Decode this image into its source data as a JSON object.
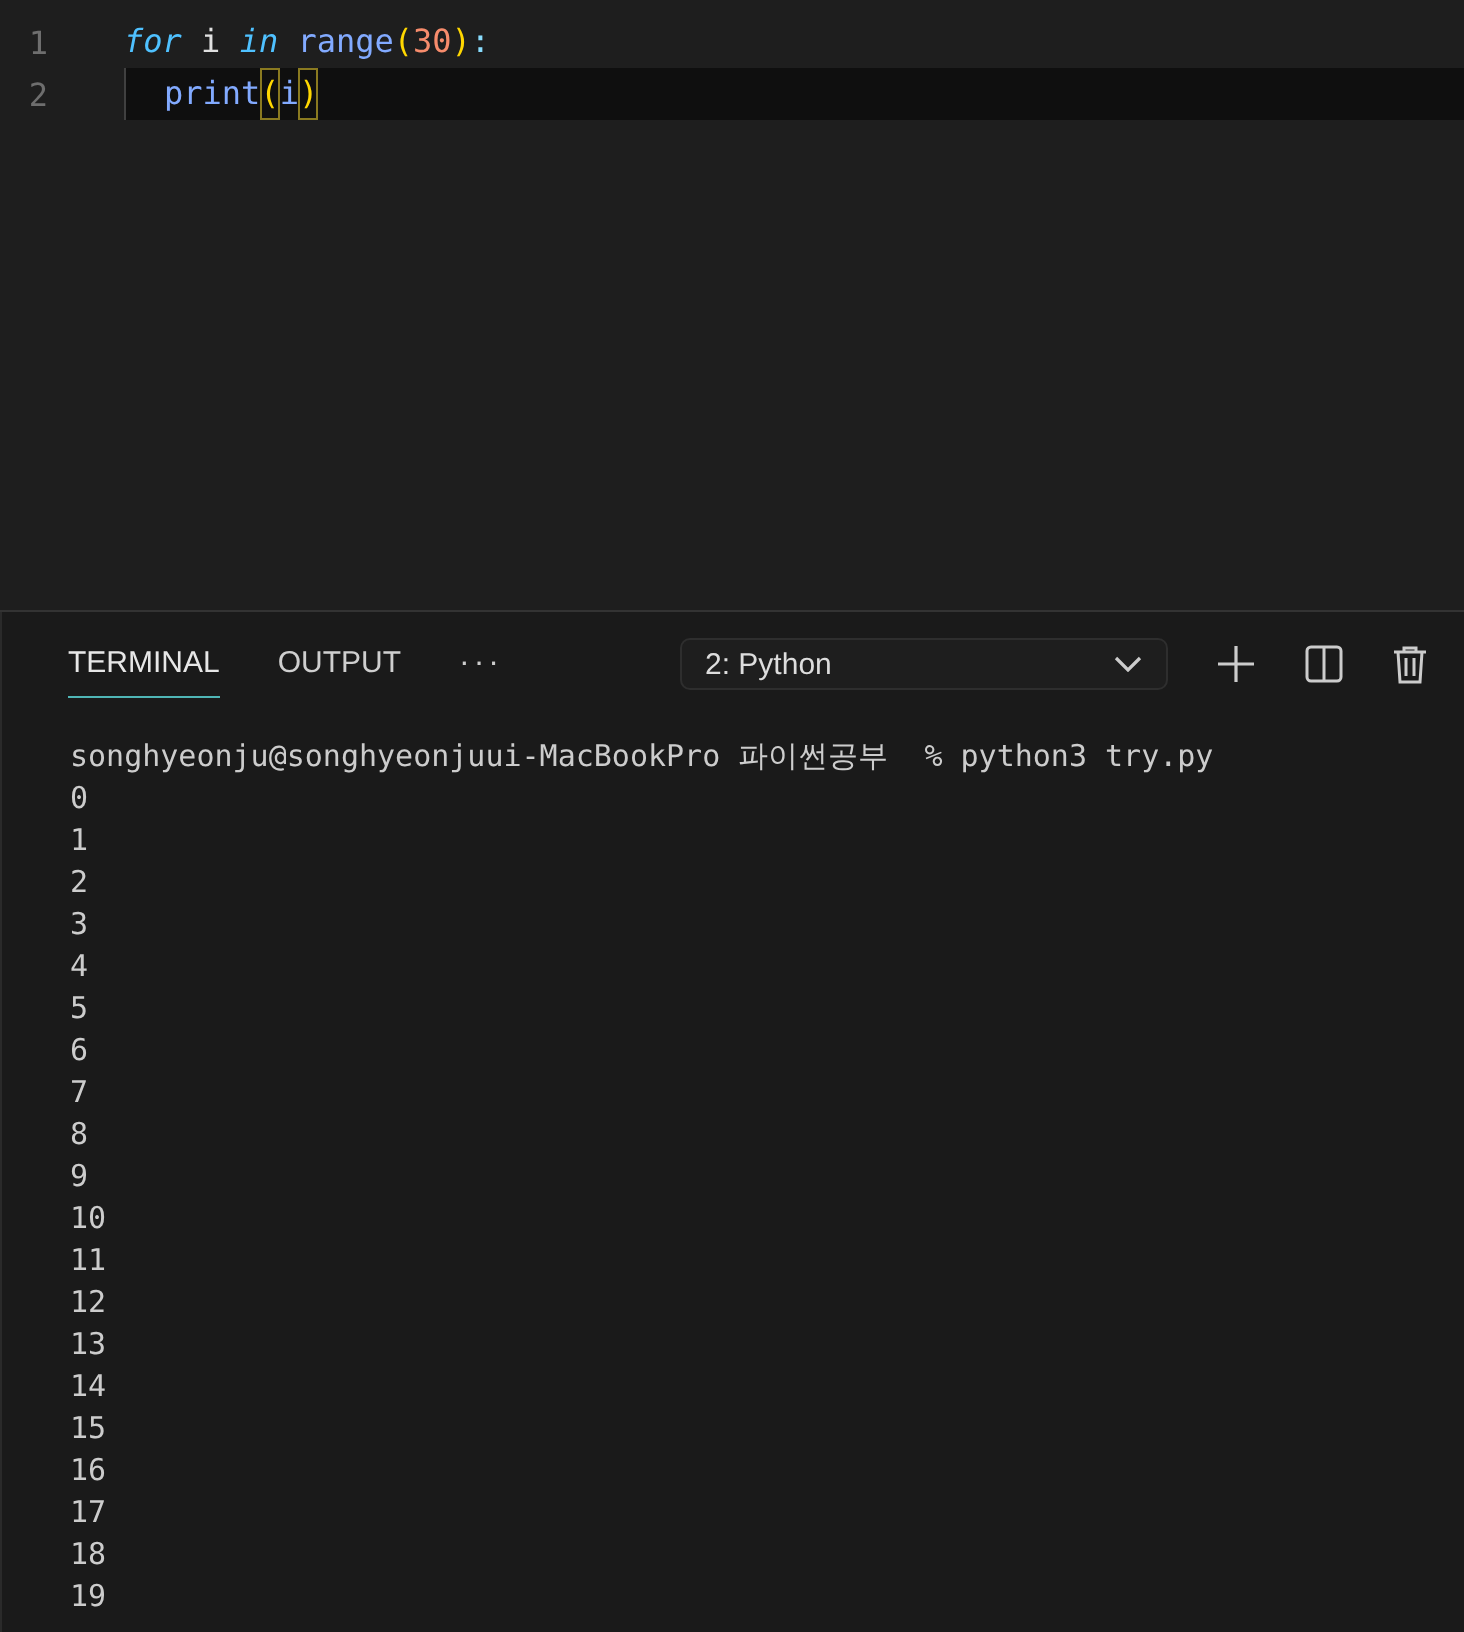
{
  "editor": {
    "lines": [
      {
        "number": "1",
        "current": false,
        "indent": false,
        "tokens": [
          {
            "text": "for",
            "kind": "keyword"
          },
          {
            "text": " i ",
            "kind": "plain"
          },
          {
            "text": "in",
            "kind": "keyword"
          },
          {
            "text": " range",
            "kind": "func"
          },
          {
            "text": "(",
            "kind": "paren"
          },
          {
            "text": "30",
            "kind": "number"
          },
          {
            "text": ")",
            "kind": "paren"
          },
          {
            "text": ":",
            "kind": "punct"
          }
        ]
      },
      {
        "number": "2",
        "current": true,
        "indent": true,
        "tokens": [
          {
            "text": "print",
            "kind": "func"
          },
          {
            "text": "(",
            "kind": "paren-match"
          },
          {
            "text": "i",
            "kind": "func"
          },
          {
            "text": ")",
            "kind": "paren-match"
          }
        ]
      }
    ]
  },
  "panel": {
    "tabs": [
      {
        "label": "TERMINAL",
        "selected": true
      },
      {
        "label": "OUTPUT",
        "selected": false
      }
    ],
    "more": "···",
    "terminal_select": {
      "value": "2: Python"
    }
  },
  "terminal": {
    "lines": [
      "songhyeonju@songhyeonjuui-MacBookPro 파이썬공부  % python3 try.py",
      "0",
      "1",
      "2",
      "3",
      "4",
      "5",
      "6",
      "7",
      "8",
      "9",
      "10",
      "11",
      "12",
      "13",
      "14",
      "15",
      "16",
      "17",
      "18",
      "19"
    ]
  }
}
